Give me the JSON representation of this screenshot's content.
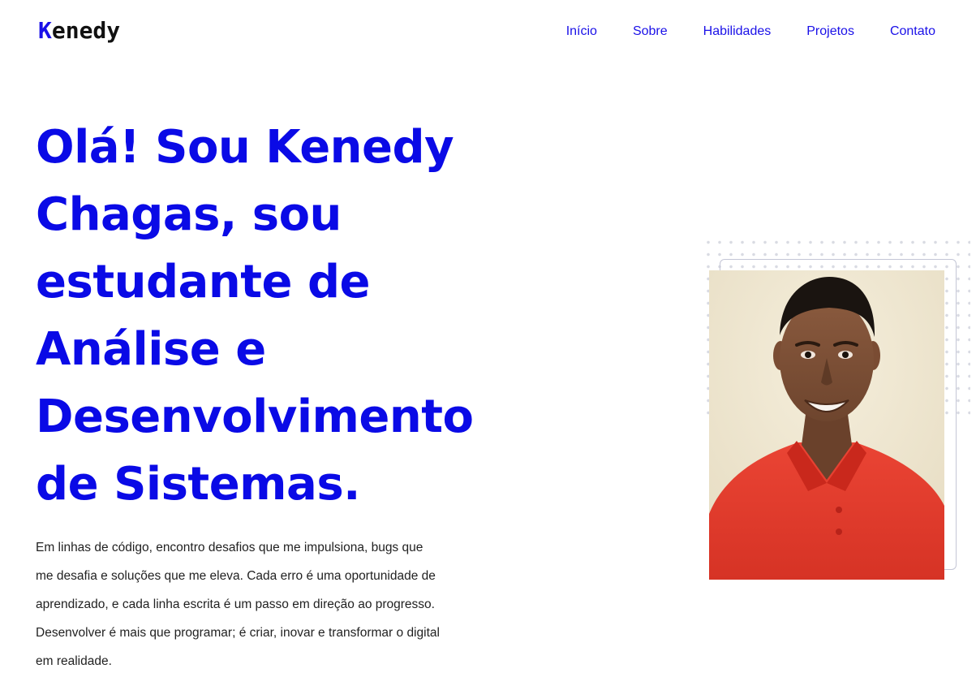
{
  "header": {
    "logo_first": "K",
    "logo_rest": "enedy",
    "nav": [
      {
        "label": "Início"
      },
      {
        "label": "Sobre"
      },
      {
        "label": "Habilidades"
      },
      {
        "label": "Projetos"
      },
      {
        "label": "Contato"
      }
    ]
  },
  "hero": {
    "title": "Olá! Sou Kenedy Chagas, sou estudante de Análise e Desenvolvimento de Sistemas.",
    "description": "Em linhas de código, encontro desafios que me impulsiona, bugs que me desafia e soluções que me eleva. Cada erro é uma oportunidade de aprendizado, e cada linha escrita é um passo em direção ao progresso. Desenvolver é mais que programar; é criar, inovar e transformar o digital em realidade."
  },
  "colors": {
    "accent": "#0a0ae6",
    "text": "#222222",
    "shirt": "#e23a2c",
    "photo_background": "#efe6cf"
  },
  "icons": {
    "photo": "profile-photo"
  }
}
